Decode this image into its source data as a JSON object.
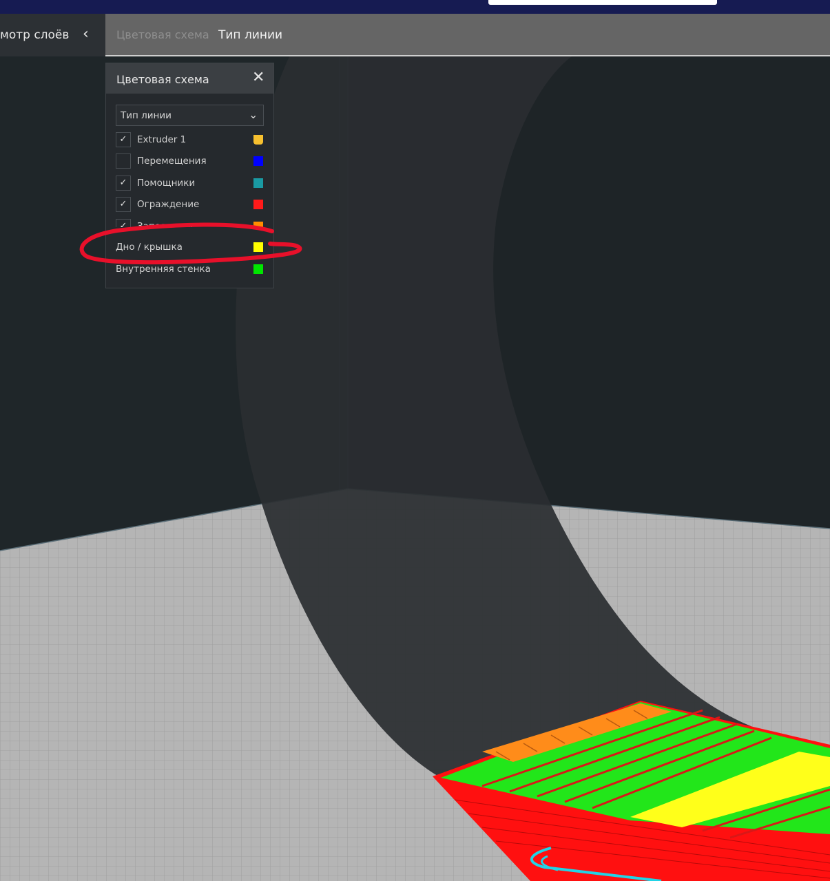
{
  "header": {
    "title": "мотр слоёв",
    "back_icon": "chevron-left-icon",
    "breadcrumb_scheme": "Цветовая схема",
    "breadcrumb_value": "Тип линии"
  },
  "panel": {
    "title": "Цветовая схема",
    "close_icon": "close-icon",
    "select_value": "Тип линии",
    "select_icon": "chevron-down-icon",
    "items": [
      {
        "label": "Extruder 1",
        "checked": true,
        "color": "#f7c02f"
      },
      {
        "label": "Перемещения",
        "checked": false,
        "color": "#0000ff"
      },
      {
        "label": "Помощники",
        "checked": true,
        "color": "#1a9aa3"
      },
      {
        "label": "Ограждение",
        "checked": true,
        "color": "#ff1a1a"
      },
      {
        "label": "Заполнение",
        "checked": true,
        "color": "#ff8c00"
      },
      {
        "label": "Дно / крышка",
        "checked": null,
        "color": "#ffff00"
      },
      {
        "label": "Внутренняя стенка",
        "checked": null,
        "color": "#00e600"
      }
    ]
  },
  "colors": {
    "background": "#1f2427",
    "toolbar": "#656565",
    "build_plate": "#b4b4b4",
    "annotation": "#e8102a"
  }
}
